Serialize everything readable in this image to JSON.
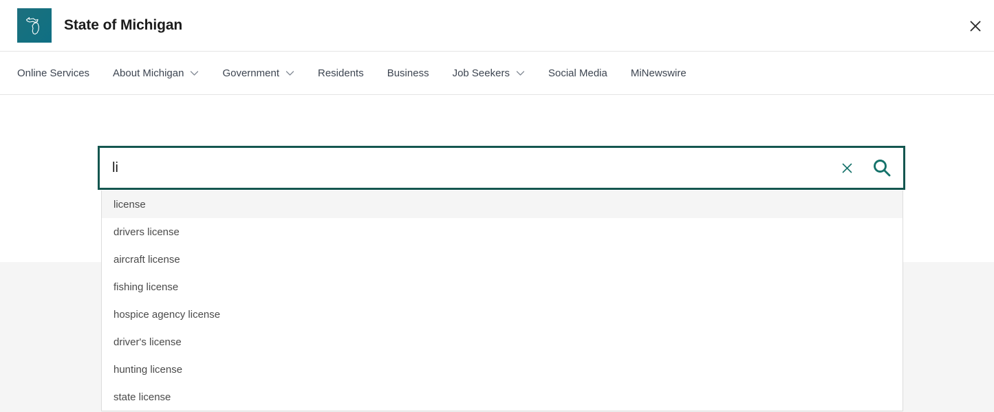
{
  "header": {
    "title": "State of Michigan",
    "logo_icon": "michigan-state-outline-icon",
    "logo_bg_color": "#16707f",
    "close_icon": "close-icon"
  },
  "nav": {
    "items": [
      {
        "label": "Online Services",
        "has_dropdown": false
      },
      {
        "label": "About Michigan",
        "has_dropdown": true
      },
      {
        "label": "Government",
        "has_dropdown": true
      },
      {
        "label": "Residents",
        "has_dropdown": false
      },
      {
        "label": "Business",
        "has_dropdown": false
      },
      {
        "label": "Job Seekers",
        "has_dropdown": true
      },
      {
        "label": "Social Media",
        "has_dropdown": false
      },
      {
        "label": "MiNewswire",
        "has_dropdown": false
      }
    ]
  },
  "search": {
    "value": "li",
    "placeholder": "",
    "border_color": "#14564f",
    "icon_color": "#14726a",
    "clear_icon": "close-icon",
    "submit_icon": "search-icon"
  },
  "suggestions": {
    "highlight_color": "#f5f5f5",
    "items": [
      {
        "label": "license",
        "active": true
      },
      {
        "label": "drivers license",
        "active": false
      },
      {
        "label": "aircraft license",
        "active": false
      },
      {
        "label": "fishing license",
        "active": false
      },
      {
        "label": "hospice agency license",
        "active": false
      },
      {
        "label": "driver's license",
        "active": false
      },
      {
        "label": "hunting license",
        "active": false
      },
      {
        "label": "state license",
        "active": false
      }
    ]
  }
}
